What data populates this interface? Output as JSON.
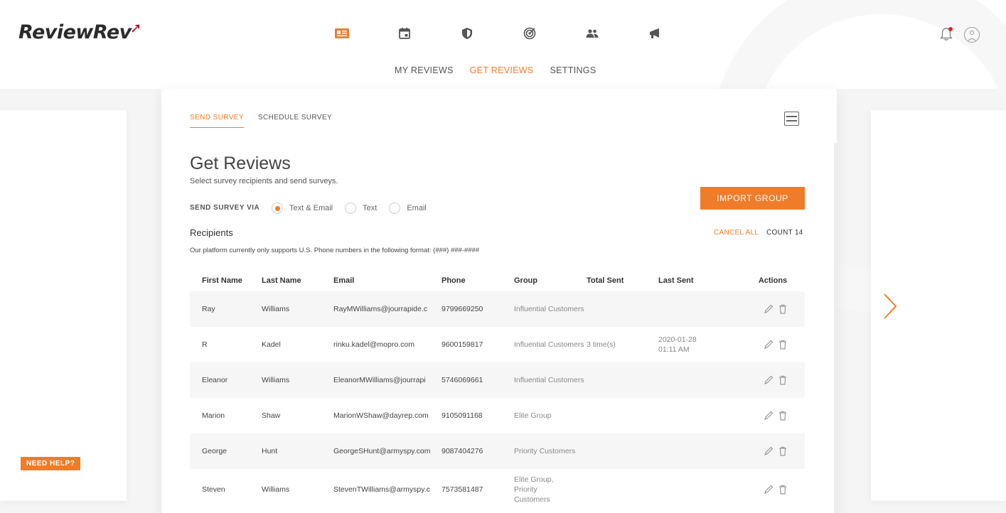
{
  "app": {
    "logo_text": "ReviewRev",
    "accent": "#f07c2a"
  },
  "top_icons": [
    {
      "name": "reviews-icon",
      "active": true
    },
    {
      "name": "calendar-icon",
      "active": false
    },
    {
      "name": "shield-icon",
      "active": false
    },
    {
      "name": "target-icon",
      "active": false
    },
    {
      "name": "users-icon",
      "active": false
    },
    {
      "name": "megaphone-icon",
      "active": false
    }
  ],
  "nav": {
    "my_reviews": "MY REVIEWS",
    "get_reviews": "GET REVIEWS",
    "settings": "SETTINGS"
  },
  "need_help": "NEED HELP?",
  "card": {
    "tab_send": "SEND SURVEY",
    "tab_schedule": "SCHEDULE SURVEY",
    "title": "Get Reviews",
    "subtitle": "Select survey recipients and send surveys.",
    "send_via_label": "SEND SURVEY VIA",
    "radio": {
      "text_email": "Text & Email",
      "text": "Text",
      "email": "Email",
      "selected": "Text & Email"
    },
    "import_button": "IMPORT GROUP",
    "recipients_label": "Recipients",
    "cancel_all": "CANCEL ALL",
    "count": "COUNT 14",
    "phone_note": "Our platform currently only supports U.S. Phone numbers in the following format: (###) ###-####"
  },
  "table": {
    "headers": {
      "first": "First Name",
      "last": "Last Name",
      "email": "Email",
      "phone": "Phone",
      "group": "Group",
      "total": "Total Sent",
      "last_sent": "Last Sent",
      "actions": "Actions"
    },
    "rows": [
      {
        "first": "Ray",
        "last": "Williams",
        "email": "RayMWilliams@jourrapide.c",
        "phone": "9799669250",
        "group": "Influential Customers",
        "total": "",
        "last_sent": ""
      },
      {
        "first": "R",
        "last": "Kadel",
        "email": "rinku.kadel@mopro.com",
        "phone": "9600159817",
        "group": "Influential Customers",
        "total": "3 time(s)",
        "last_sent": "2020-01-28 01:11 AM"
      },
      {
        "first": "Eleanor",
        "last": "Williams",
        "email": "EleanorMWilliams@jourrapi",
        "phone": "5746069661",
        "group": "Influential Customers",
        "total": "",
        "last_sent": ""
      },
      {
        "first": "Marion",
        "last": "Shaw",
        "email": "MarionWShaw@dayrep.com",
        "phone": "9105091168",
        "group": "Elite Group",
        "total": "",
        "last_sent": ""
      },
      {
        "first": "George",
        "last": "Hunt",
        "email": "GeorgeSHunt@armyspy.com",
        "phone": "9087404276",
        "group": "Priority Customers",
        "total": "",
        "last_sent": ""
      },
      {
        "first": "Steven",
        "last": "Williams",
        "email": "StevenTWilliams@armyspy.c",
        "phone": "7573581487",
        "group": "Elite Group, Priority Customers",
        "total": "",
        "last_sent": ""
      }
    ]
  }
}
